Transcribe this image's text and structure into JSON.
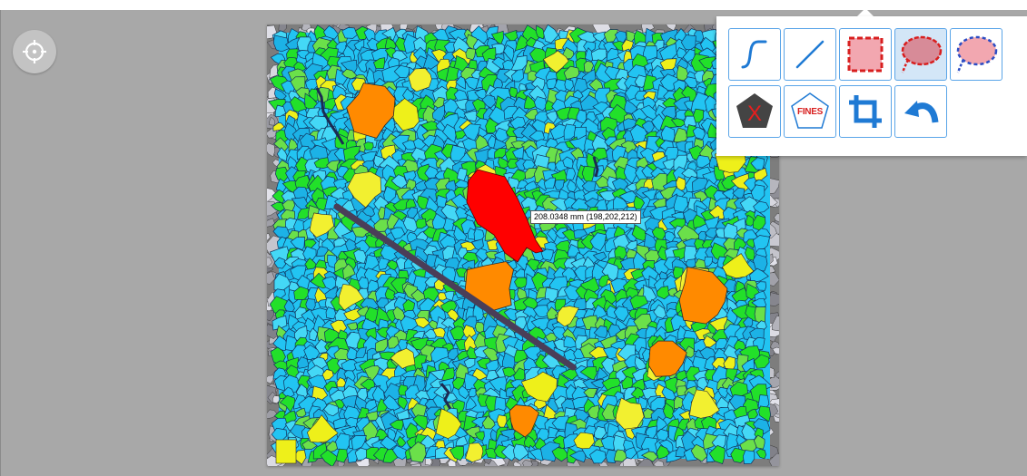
{
  "toolbar": {
    "tools": [
      {
        "id": "freehand",
        "icon": "freehand-curve-icon",
        "selected": false
      },
      {
        "id": "line",
        "icon": "line-icon",
        "selected": false
      },
      {
        "id": "rectangle",
        "icon": "rectangle-select-icon",
        "selected": false
      },
      {
        "id": "ellipse",
        "icon": "ellipse-select-icon",
        "selected": true
      },
      {
        "id": "lasso",
        "icon": "lasso-select-icon",
        "selected": false
      },
      {
        "id": "delete",
        "icon": "delete-pentagon-icon",
        "selected": false
      },
      {
        "id": "fines",
        "icon": "fines-pentagon-icon",
        "label": "FINES",
        "selected": false
      },
      {
        "id": "crop",
        "icon": "crop-icon",
        "selected": false
      },
      {
        "id": "undo",
        "icon": "undo-icon",
        "selected": false
      }
    ]
  },
  "measurement": {
    "label": "208.0348 mm (198,202,212)"
  },
  "colors": {
    "accent": "#1f7ad4",
    "selection_fill": "#f2a7b0",
    "selection_stroke": "#d81f1f",
    "particle_fine": "#22c4f2",
    "particle_small": "#22e02a",
    "particle_medium": "#eef01a",
    "particle_large": "#ff8a00",
    "particle_xlarge": "#ff0000",
    "measure_line": "#4a3e58"
  }
}
